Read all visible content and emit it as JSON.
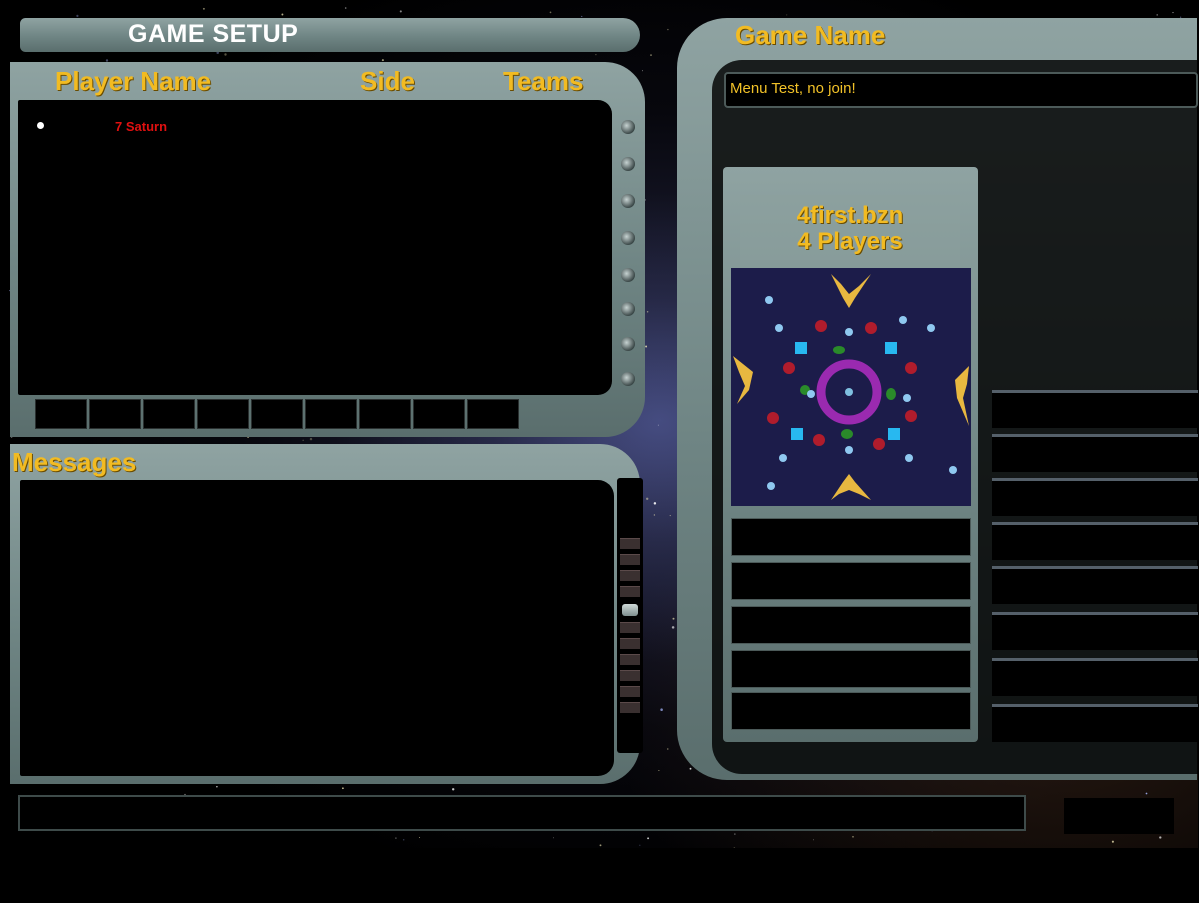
{
  "title": "GAME SETUP",
  "players_panel": {
    "headers": {
      "name": "Player Name",
      "side": "Side",
      "teams": "Teams"
    },
    "players": [
      {
        "name": "7 Saturn",
        "color": "#e01010"
      }
    ],
    "slot_count": 9
  },
  "messages": {
    "label": "Messages",
    "lines": []
  },
  "game": {
    "label": "Game Name",
    "name_value": "Menu Test, no join!",
    "map_file": "4first.bzn",
    "map_players": "4 Players"
  },
  "colors": {
    "accent": "#f2bb22",
    "frame": "#7d9190",
    "player": "#e01010"
  }
}
